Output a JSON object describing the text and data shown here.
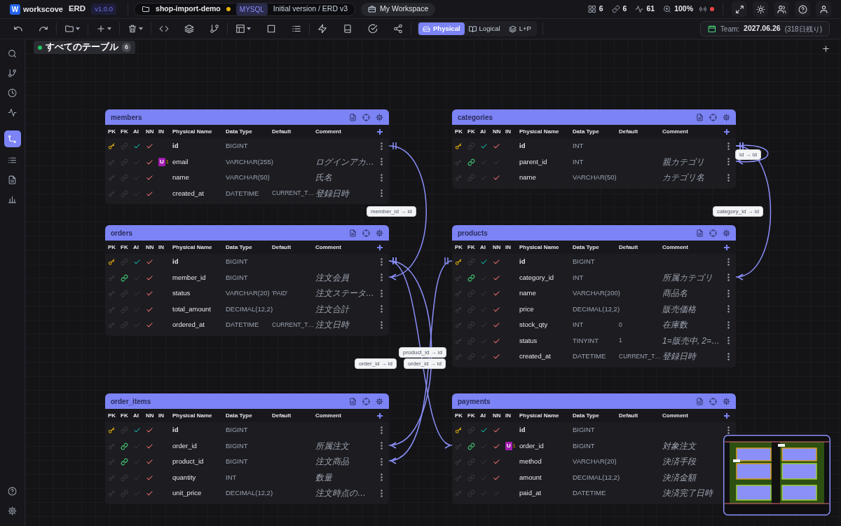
{
  "app": {
    "logo_letter": "W",
    "name": "workscove",
    "product": "ERD",
    "version": "v1.0.0"
  },
  "project": {
    "name": "shop-import-demo",
    "unsaved": true,
    "dialect": "MYSQL",
    "version_label": "Initial version / ERD v3"
  },
  "workspace": {
    "label": "My Workspace"
  },
  "stats": {
    "tables": "6",
    "links": "6",
    "activity": "61",
    "zoom": "100%",
    "connected": false
  },
  "view_modes": [
    {
      "label": "Physical",
      "selected": true
    },
    {
      "label": "Logical",
      "selected": false
    },
    {
      "label": "L+P",
      "selected": false
    }
  ],
  "team": {
    "label": "Team:",
    "date": "2027.06.26",
    "remaining": "(318日残り)"
  },
  "sidebar": {
    "items": [
      {
        "selected": false
      },
      {
        "selected": false
      },
      {
        "selected": false
      },
      {
        "selected": false
      },
      {
        "selected": true
      },
      {
        "selected": false
      },
      {
        "selected": false
      },
      {
        "selected": false
      }
    ]
  },
  "table_tabs": [
    {
      "label": "すべてのテーブル",
      "count": "6",
      "selected": true
    }
  ],
  "tables": [
    {
      "name": "members",
      "headers": [
        "PK",
        "FK",
        "AI",
        "NN",
        "IN",
        "Physical Name",
        "Data Type",
        "Default",
        "Comment"
      ],
      "columns": [
        {
          "pk": true,
          "fk": false,
          "ai": true,
          "nn": true,
          "name": "id",
          "type": "BIGINT"
        },
        {
          "pk": false,
          "fk": false,
          "ai": false,
          "nn": true,
          "index": {
            "badge": "U",
            "group": "1"
          },
          "name": "email",
          "type": "VARCHAR(255)",
          "comment": "ログインアカ…"
        },
        {
          "pk": false,
          "fk": false,
          "ai": false,
          "nn": true,
          "name": "name",
          "type": "VARCHAR(50)",
          "comment": "氏名"
        },
        {
          "pk": false,
          "fk": false,
          "ai": false,
          "nn": true,
          "name": "created_at",
          "type": "DATETIME",
          "default": "CURRENT_T…",
          "comment": "登録日時"
        }
      ]
    },
    {
      "name": "categories",
      "headers": [
        "PK",
        "FK",
        "AI",
        "NN",
        "IN",
        "Physical Name",
        "Data Type",
        "Default",
        "Comment"
      ],
      "columns": [
        {
          "pk": true,
          "fk": false,
          "ai": true,
          "nn": true,
          "name": "id",
          "type": "INT"
        },
        {
          "pk": false,
          "fk": true,
          "ai": false,
          "nn": false,
          "name": "parent_id",
          "type": "INT",
          "comment": "親カテゴリ"
        },
        {
          "pk": false,
          "fk": false,
          "ai": false,
          "nn": true,
          "name": "name",
          "type": "VARCHAR(50)",
          "comment": "カテゴリ名"
        }
      ]
    },
    {
      "name": "orders",
      "headers": [
        "PK",
        "FK",
        "AI",
        "NN",
        "IN",
        "Physical Name",
        "Data Type",
        "Default",
        "Comment"
      ],
      "columns": [
        {
          "pk": true,
          "fk": false,
          "ai": true,
          "nn": true,
          "name": "id",
          "type": "BIGINT"
        },
        {
          "pk": false,
          "fk": true,
          "ai": false,
          "nn": true,
          "name": "member_id",
          "type": "BIGINT",
          "comment": "注文会員"
        },
        {
          "pk": false,
          "fk": false,
          "ai": false,
          "nn": true,
          "name": "status",
          "type": "VARCHAR(20)",
          "default": "'PAID'",
          "comment": "注文ステータ…"
        },
        {
          "pk": false,
          "fk": false,
          "ai": false,
          "nn": true,
          "name": "total_amount",
          "type": "DECIMAL(12,2)",
          "comment": "注文合計"
        },
        {
          "pk": false,
          "fk": false,
          "ai": false,
          "nn": true,
          "name": "ordered_at",
          "type": "DATETIME",
          "default": "CURRENT_T…",
          "comment": "注文日時"
        }
      ]
    },
    {
      "name": "products",
      "headers": [
        "PK",
        "FK",
        "AI",
        "NN",
        "IN",
        "Physical Name",
        "Data Type",
        "Default",
        "Comment"
      ],
      "columns": [
        {
          "pk": true,
          "fk": false,
          "ai": true,
          "nn": true,
          "name": "id",
          "type": "BIGINT"
        },
        {
          "pk": false,
          "fk": true,
          "ai": false,
          "nn": true,
          "name": "category_id",
          "type": "INT",
          "comment": "所属カテゴリ"
        },
        {
          "pk": false,
          "fk": false,
          "ai": false,
          "nn": true,
          "name": "name",
          "type": "VARCHAR(200)",
          "comment": "商品名"
        },
        {
          "pk": false,
          "fk": false,
          "ai": false,
          "nn": true,
          "name": "price",
          "type": "DECIMAL(12,2)",
          "comment": "販売価格"
        },
        {
          "pk": false,
          "fk": false,
          "ai": false,
          "nn": true,
          "name": "stock_qty",
          "type": "INT",
          "default": "0",
          "comment": "在庫数"
        },
        {
          "pk": false,
          "fk": false,
          "ai": false,
          "nn": true,
          "name": "status",
          "type": "TINYINT",
          "default": "1",
          "comment": "1=販売中, 2=…"
        },
        {
          "pk": false,
          "fk": false,
          "ai": false,
          "nn": true,
          "name": "created_at",
          "type": "DATETIME",
          "default": "CURRENT_T…",
          "comment": "登録日時"
        }
      ]
    },
    {
      "name": "order_items",
      "headers": [
        "PK",
        "FK",
        "AI",
        "NN",
        "IN",
        "Physical Name",
        "Data Type",
        "Default",
        "Comment"
      ],
      "columns": [
        {
          "pk": true,
          "fk": false,
          "ai": true,
          "nn": true,
          "name": "id",
          "type": "BIGINT"
        },
        {
          "pk": false,
          "fk": true,
          "ai": false,
          "nn": true,
          "name": "order_id",
          "type": "BIGINT",
          "comment": "所属注文"
        },
        {
          "pk": false,
          "fk": true,
          "ai": false,
          "nn": true,
          "name": "product_id",
          "type": "BIGINT",
          "comment": "注文商品"
        },
        {
          "pk": false,
          "fk": false,
          "ai": false,
          "nn": true,
          "name": "quantity",
          "type": "INT",
          "comment": "数量"
        },
        {
          "pk": false,
          "fk": false,
          "ai": false,
          "nn": true,
          "name": "unit_price",
          "type": "DECIMAL(12,2)",
          "comment": "注文時点の…"
        }
      ]
    },
    {
      "name": "payments",
      "headers": [
        "PK",
        "FK",
        "AI",
        "NN",
        "IN",
        "Physical Name",
        "Data Type",
        "Default",
        "Comment"
      ],
      "columns": [
        {
          "pk": true,
          "fk": false,
          "ai": true,
          "nn": true,
          "name": "id",
          "type": "BIGINT"
        },
        {
          "pk": false,
          "fk": true,
          "ai": false,
          "nn": true,
          "index": {
            "badge": "U",
            "group": "1"
          },
          "name": "order_id",
          "type": "BIGINT",
          "comment": "対象注文"
        },
        {
          "pk": false,
          "fk": false,
          "ai": false,
          "nn": true,
          "name": "method",
          "type": "VARCHAR(20)",
          "comment": "決済手段"
        },
        {
          "pk": false,
          "fk": false,
          "ai": false,
          "nn": true,
          "name": "amount",
          "type": "DECIMAL(12,2)",
          "comment": "決済金額"
        },
        {
          "pk": false,
          "fk": false,
          "ai": false,
          "nn": false,
          "name": "paid_at",
          "type": "DATETIME",
          "comment": "決済完了日時"
        }
      ]
    }
  ],
  "relationships": [
    {
      "label": "id → id"
    },
    {
      "label": "member_id → id"
    },
    {
      "label": "category_id → id"
    },
    {
      "label": "product_id → id"
    },
    {
      "label": "order_id → id"
    },
    {
      "label": "order_id → id"
    }
  ]
}
